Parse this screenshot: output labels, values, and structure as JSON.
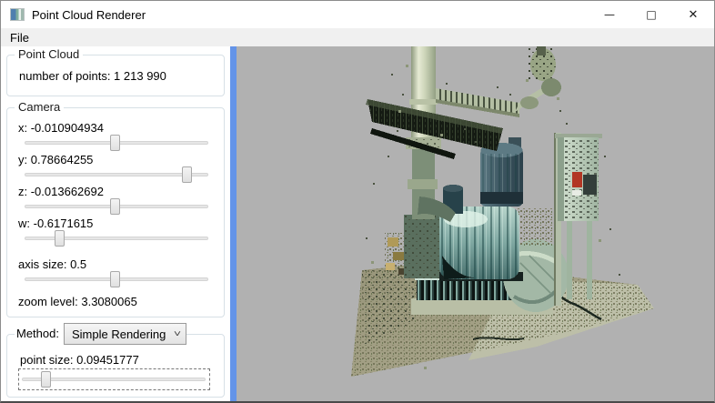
{
  "window": {
    "title": "Point Cloud Renderer",
    "controls": {
      "minimize": "—",
      "maximize": "□",
      "close": "✕"
    }
  },
  "menubar": {
    "items": [
      {
        "label": "File"
      }
    ]
  },
  "sidebar": {
    "point_cloud_group": {
      "title": "Point Cloud",
      "number_of_points": "number of points: 1 213 990"
    },
    "camera_group": {
      "title": "Camera",
      "sliders": [
        {
          "id": "x",
          "label": "x: -0.010904934",
          "percent": 49,
          "extra_gap": false
        },
        {
          "id": "y",
          "label": "y: 0.78664255",
          "percent": 88,
          "extra_gap": false
        },
        {
          "id": "z",
          "label": "z: -0.013662692",
          "percent": 49,
          "extra_gap": false
        },
        {
          "id": "w",
          "label": "w: -0.6171615",
          "percent": 19,
          "extra_gap": false
        },
        {
          "id": "axis-size",
          "label": "axis size: 0.5",
          "percent": 49,
          "extra_gap": true
        }
      ],
      "zoom_label": "zoom level: 3.3080065"
    },
    "method_group": {
      "title": "Method:",
      "combo_value": "Simple Rendering",
      "point_size_slider": {
        "label": "point size: 0.09451777",
        "percent": 13,
        "focused": true
      }
    }
  },
  "viewport": {
    "colors": {
      "background": "#b1b1b1",
      "splitter": "#6494e8"
    }
  }
}
